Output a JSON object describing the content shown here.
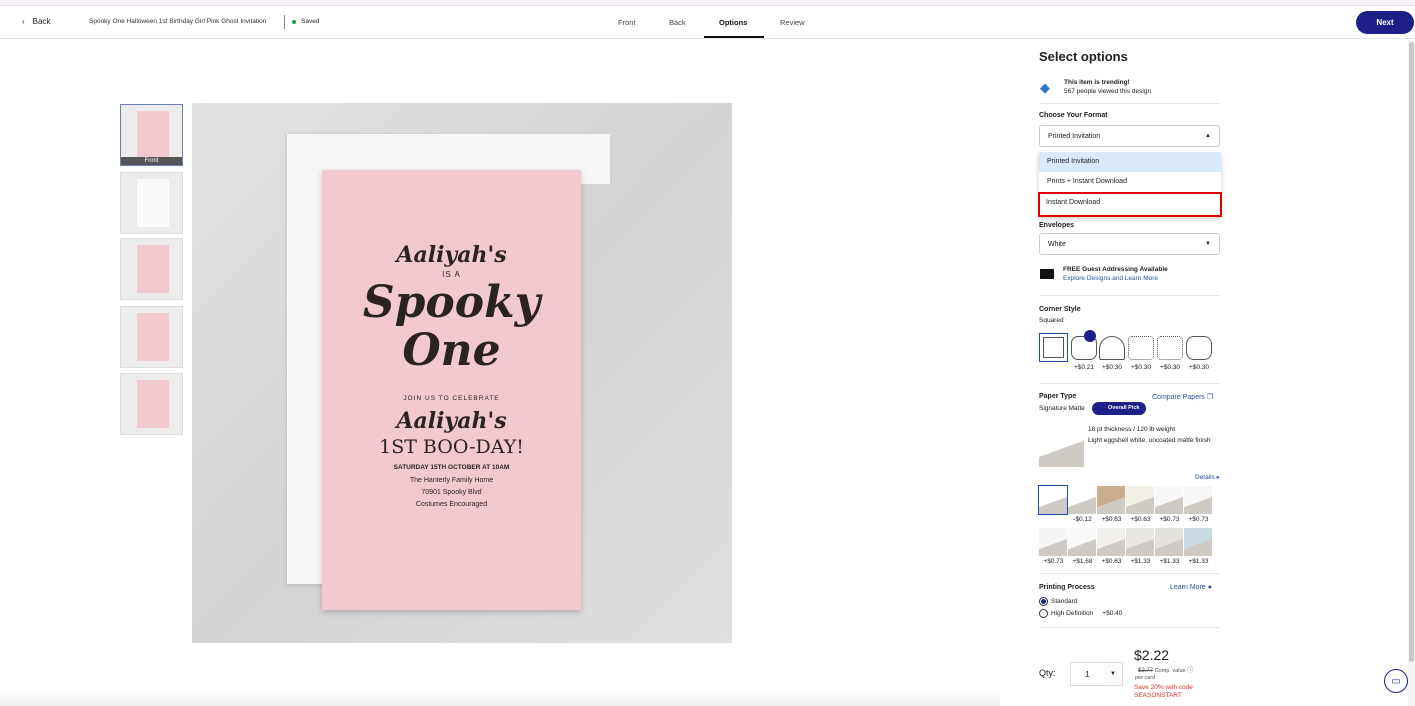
{
  "header": {
    "back": "Back",
    "title": "Spooky One Halloween 1st Birthday Girl Pink Ghost Invitation",
    "saved": "Saved",
    "tabs": [
      "Front",
      "Back",
      "Options",
      "Review"
    ],
    "next": "Next"
  },
  "thumbnails": {
    "front_label": "Front"
  },
  "card": {
    "name1": "Aaliyah's",
    "is_a": "IS A",
    "spooky": "Spooky",
    "one": "One",
    "join": "JOIN US TO CELEBRATE",
    "name2": "Aaliyah's",
    "boo": "1ST BOO-DAY!",
    "date": "SATURDAY 15TH OCTOBER AT 10AM",
    "place": "The Hanterly Family Home",
    "address": "70901 Spooky Blvd",
    "costumes": "Costumes Encouraged"
  },
  "options": {
    "title": "Select options",
    "trending": "This item is trending!",
    "viewed": "567 people viewed this design",
    "format_label": "Choose Your Format",
    "format_value": "Printed Invitation",
    "format_options": [
      "Printed Invitation",
      "Prints + Instant Download",
      "Instant Download"
    ],
    "envelopes_label": "Envelopes",
    "envelopes_value": "White",
    "addressing_title": "FREE Guest Addressing Available",
    "addressing_link": "Explore Designs and Learn More",
    "corner_label": "Corner Style",
    "corner_value": "Squared",
    "corner_prices": [
      "+$0.21",
      "+$0.30",
      "+$0.30",
      "+$0.30",
      "+$0.30"
    ],
    "paper_label": "Paper Type",
    "compare": "Compare Papers",
    "paper_value": "Signature Matte",
    "badge": "Overall Pick",
    "paper_desc1": "18 pt thickness / 120 lb weight",
    "paper_desc2": "Light eggshell white, uncoated matte finish",
    "details": "Details",
    "paper_prices": [
      "",
      "-$0.12",
      "+$0.63",
      "+$0.63",
      "+$0.73",
      "+$0.73",
      "+$0.73",
      "+$1.68",
      "+$0.63",
      "+$1.33",
      "+$1.33",
      "+$1.33"
    ],
    "printing_label": "Printing Process",
    "learn_more": "Learn More",
    "standard": "Standard",
    "hd": "High Definition",
    "hd_price": "+$0.40",
    "qty_label": "Qty:",
    "qty": "1",
    "price": "$2.22",
    "comp_price": "$2.77",
    "comp_label": "Comp. value",
    "per_card": "per card",
    "promo": "Save 20% with code",
    "code": "SEASONSTART"
  },
  "colors": {
    "accent": "#1d2088",
    "highlight": "#e00000"
  }
}
